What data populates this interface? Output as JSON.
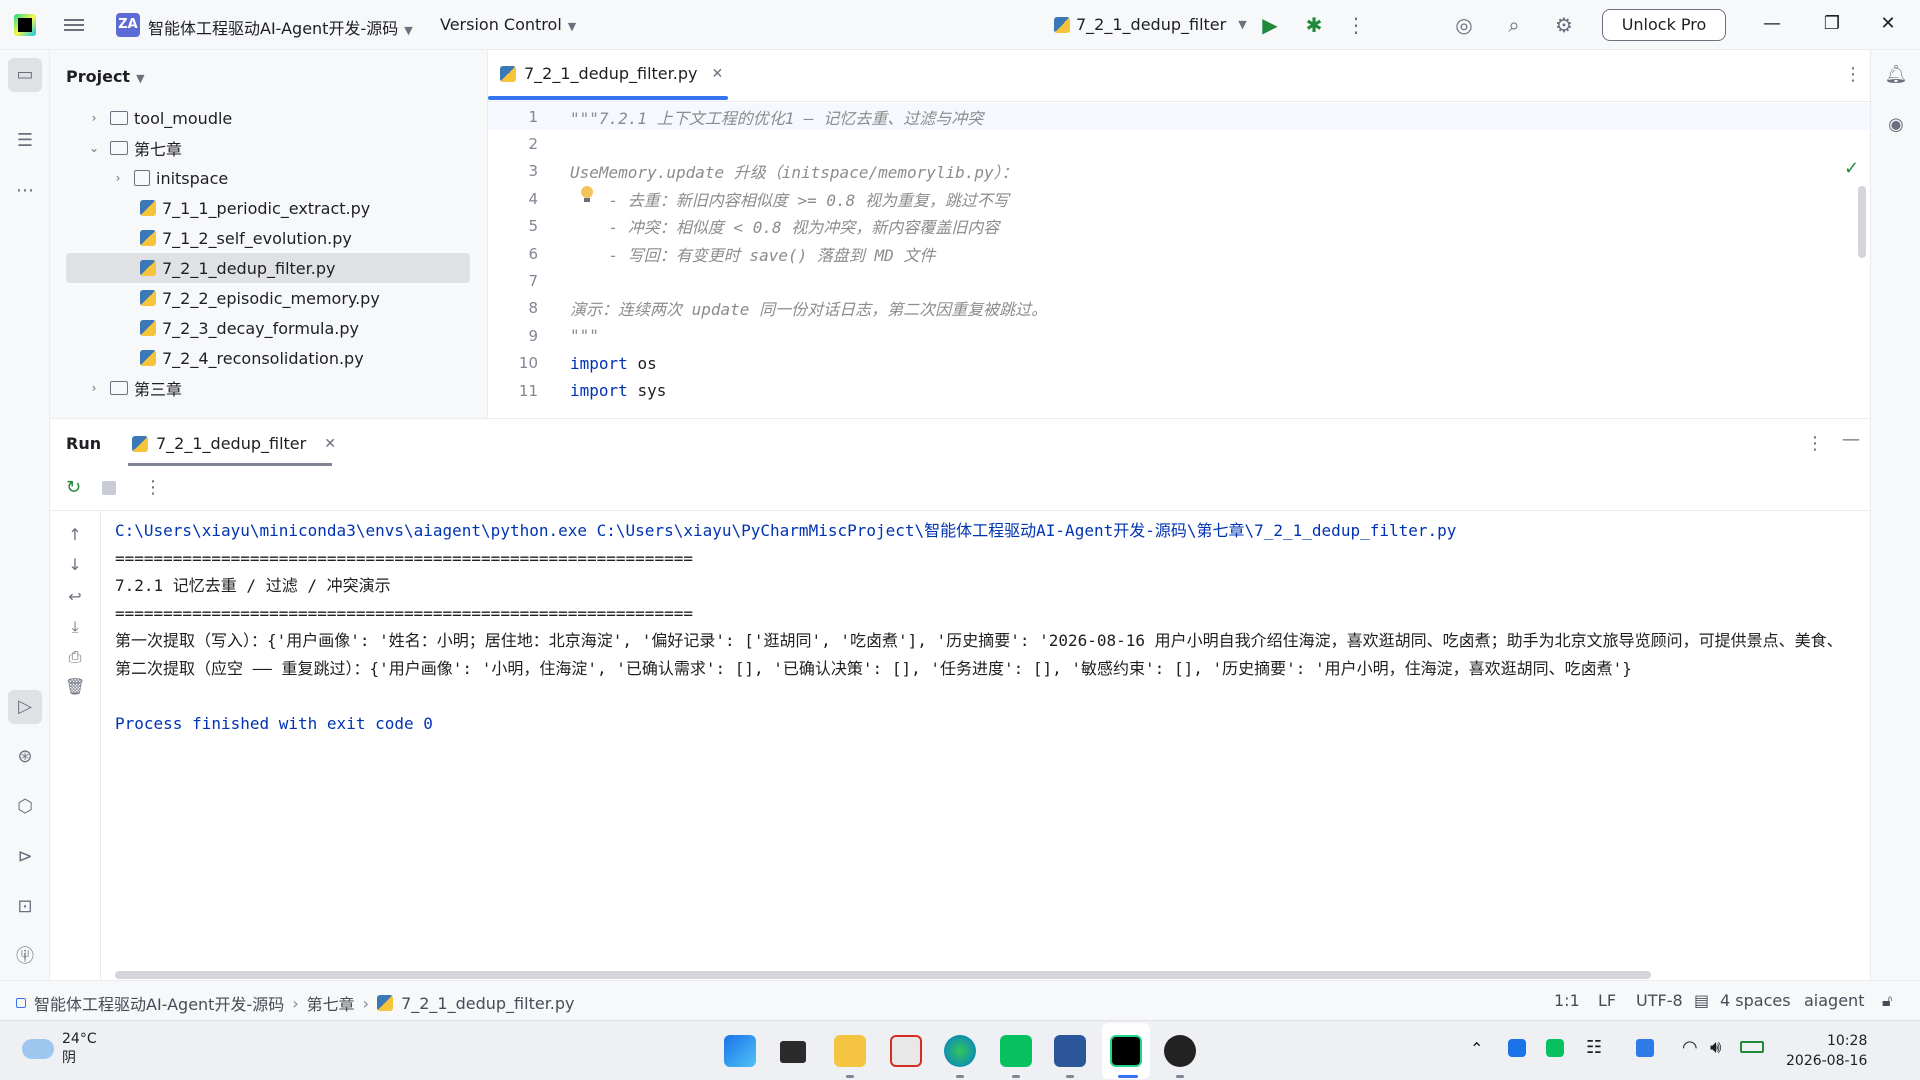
{
  "titlebar": {
    "project_badge": "ZA",
    "project_name": "智能体工程驱动AI-Agent开发-源码",
    "vcs": "Version Control",
    "run_config": "7_2_1_dedup_filter",
    "unlock": "Unlock Pro"
  },
  "project": {
    "title": "Project",
    "tree": [
      {
        "label": "tool_moudle",
        "type": "folder",
        "expanded": false
      },
      {
        "label": "第七章",
        "type": "folder",
        "expanded": true
      },
      {
        "label": "initspace",
        "type": "package",
        "expanded": false
      },
      {
        "label": "7_1_1_periodic_extract.py",
        "type": "python"
      },
      {
        "label": "7_1_2_self_evolution.py",
        "type": "python"
      },
      {
        "label": "7_2_1_dedup_filter.py",
        "type": "python",
        "selected": true
      },
      {
        "label": "7_2_2_episodic_memory.py",
        "type": "python"
      },
      {
        "label": "7_2_3_decay_formula.py",
        "type": "python"
      },
      {
        "label": "7_2_4_reconsolidation.py",
        "type": "python"
      },
      {
        "label": "第三章",
        "type": "folder",
        "expanded": false
      }
    ]
  },
  "editor": {
    "tab": "7_2_1_dedup_filter.py",
    "lines": [
      {
        "n": "1",
        "text": "\"\"\"7.2.1 上下文工程的优化1 — 记忆去重、过滤与冲突",
        "style": "doc"
      },
      {
        "n": "2",
        "text": "",
        "style": "doc"
      },
      {
        "n": "3",
        "text": "UseMemory.update 升级（initspace/memorylib.py）：",
        "style": "doc"
      },
      {
        "n": "4",
        "text": "    - 去重：新旧内容相似度 >= 0.8 视为重复，跳过不写",
        "style": "doc"
      },
      {
        "n": "5",
        "text": "    - 冲突：相似度 < 0.8 视为冲突，新内容覆盖旧内容",
        "style": "doc"
      },
      {
        "n": "6",
        "text": "    - 写回：有变更时 save() 落盘到 MD 文件",
        "style": "doc"
      },
      {
        "n": "7",
        "text": "",
        "style": "doc"
      },
      {
        "n": "8",
        "text": "演示：连续两次 update 同一份对话日志，第二次因重复被跳过。",
        "style": "doc"
      },
      {
        "n": "9",
        "text": "\"\"\"",
        "style": "doc"
      },
      {
        "n": "10",
        "text": "import os",
        "style": "code"
      },
      {
        "n": "11",
        "text": "import sys",
        "style": "code"
      }
    ]
  },
  "run": {
    "label": "Run",
    "tab": "7_2_1_dedup_filter",
    "console": [
      {
        "text": "C:\\Users\\xiayu\\miniconda3\\envs\\aiagent\\python.exe C:\\Users\\xiayu\\PyCharmMiscProject\\智能体工程驱动AI-Agent开发-源码\\第七章\\7_2_1_dedup_filter.py",
        "style": "blue"
      },
      {
        "text": "============================================================",
        "style": "normal"
      },
      {
        "text": "7.2.1 记忆去重 / 过滤 / 冲突演示",
        "style": "normal"
      },
      {
        "text": "============================================================",
        "style": "normal"
      },
      {
        "text": "第一次提取（写入）：{'用户画像': '姓名：小明；居住地：北京海淀', '偏好记录': ['逛胡同', '吃卤煮'], '历史摘要': '2026-08-16 用户小明自我介绍住海淀，喜欢逛胡同、吃卤煮；助手为北京文旅导览顾问，可提供景点、美食、",
        "style": "normal"
      },
      {
        "text": "第二次提取（应空 —— 重复跳过）：{'用户画像': '小明，住海淀', '已确认需求': [], '已确认决策': [], '任务进度': [], '敏感约束': [], '历史摘要': '用户小明，住海淀，喜欢逛胡同、吃卤煮'}",
        "style": "normal"
      },
      {
        "text": "",
        "style": "normal"
      },
      {
        "text": "Process finished with exit code 0",
        "style": "blue"
      }
    ]
  },
  "statusbar": {
    "crumbs": [
      "智能体工程驱动AI-Agent开发-源码",
      "第七章",
      "7_2_1_dedup_filter.py"
    ],
    "position": "1:1",
    "line_sep": "LF",
    "encoding": "UTF-8",
    "indent": "4 spaces",
    "interpreter": "aiagent"
  },
  "taskbar": {
    "temp": "24°C",
    "weather": "阴",
    "time": "10:28",
    "date": "2026-08-16"
  }
}
